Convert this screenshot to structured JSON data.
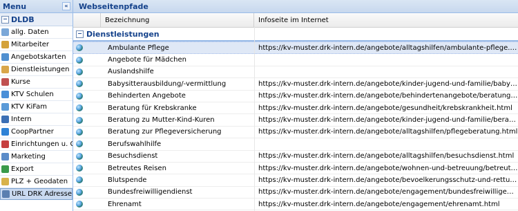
{
  "sidebar": {
    "title": "Menu",
    "collapse_glyph": "«",
    "group_label": "DLDB",
    "group_toggle": "−",
    "items": [
      {
        "label": "allg. Daten",
        "icon": "document-icon",
        "color": "#7aa7d8"
      },
      {
        "label": "Mitarbeiter",
        "icon": "people-icon",
        "color": "#d4a23a"
      },
      {
        "label": "Angebotskarten",
        "icon": "card-icon",
        "color": "#4f8fd0"
      },
      {
        "label": "Dienstleistungen",
        "icon": "service-icon",
        "color": "#d9a64a"
      },
      {
        "label": "Kurse",
        "icon": "course-icon",
        "color": "#c05050"
      },
      {
        "label": "KTV Schulen",
        "icon": "school-icon",
        "color": "#4a8fd8"
      },
      {
        "label": "KTV KiFam",
        "icon": "family-icon",
        "color": "#5a9ad8"
      },
      {
        "label": "Intern",
        "icon": "intern-icon",
        "color": "#3b6fb5"
      },
      {
        "label": "CoopPartner",
        "icon": "partner-icon",
        "color": "#2e82d6"
      },
      {
        "label": "Einrichtungen u. G.",
        "icon": "building-icon",
        "color": "#c64040"
      },
      {
        "label": "Marketing",
        "icon": "chart-icon",
        "color": "#5b8cc9"
      },
      {
        "label": "Export",
        "icon": "export-icon",
        "color": "#3a9a4a"
      },
      {
        "label": "PLZ + Geodaten",
        "icon": "postcode-icon",
        "color": "#d8b24a"
      },
      {
        "label": "URL DRK Adressen",
        "icon": "url-icon",
        "color": "#5a7fb0"
      }
    ]
  },
  "main": {
    "title": "Webseitenpfade",
    "columns": {
      "name": "Bezeichnung",
      "url": "Infoseite im Internet"
    },
    "group_label": "Dienstleistungen",
    "group_toggle": "−",
    "rows": [
      {
        "name": "Ambulante Pflege",
        "url": "https://kv-muster.drk-intern.de/angebote/alltagshilfen/ambulante-pflege.html"
      },
      {
        "name": "Angebote für Mädchen",
        "url": ""
      },
      {
        "name": "Auslandshilfe",
        "url": ""
      },
      {
        "name": "Babysitterausbildung/-vermittlung",
        "url": "https://kv-muster.drk-intern.de/angebote/kinder-jugend-und-familie/babysitterausbildung..."
      },
      {
        "name": "Behinderten Angebote",
        "url": "https://kv-muster.drk-intern.de/angebote/behindertenangebote/beratung-und-unterstuet..."
      },
      {
        "name": "Beratung für Krebskranke",
        "url": "https://kv-muster.drk-intern.de/angebote/gesundheit/krebskrankheit.html"
      },
      {
        "name": "Beratung zu Mutter-Kind-Kuren",
        "url": "https://kv-muster.drk-intern.de/angebote/kinder-jugend-und-familie/beratung-zu-mutter-..."
      },
      {
        "name": "Beratung zur Pflegeversicherung",
        "url": "https://kv-muster.drk-intern.de/angebote/alltagshilfen/pflegeberatung.html"
      },
      {
        "name": "Berufswahlhilfe",
        "url": ""
      },
      {
        "name": "Besuchsdienst",
        "url": "https://kv-muster.drk-intern.de/angebote/alltagshilfen/besuchsdienst.html"
      },
      {
        "name": "Betreutes Reisen",
        "url": "https://kv-muster.drk-intern.de/angebote/wohnen-und-betreuung/betreutes-reisen.html"
      },
      {
        "name": "Blutspende",
        "url": "https://kv-muster.drk-intern.de/angebote/bevoelkerungsschutz-und-rettung/blutspende..."
      },
      {
        "name": "Bundesfreiwilligendienst",
        "url": "https://kv-muster.drk-intern.de/angebote/engagement/bundesfreiwilligendienst.html"
      },
      {
        "name": "Ehrenamt",
        "url": "https://kv-muster.drk-intern.de/angebote/engagement/ehrenamt.html"
      }
    ]
  }
}
